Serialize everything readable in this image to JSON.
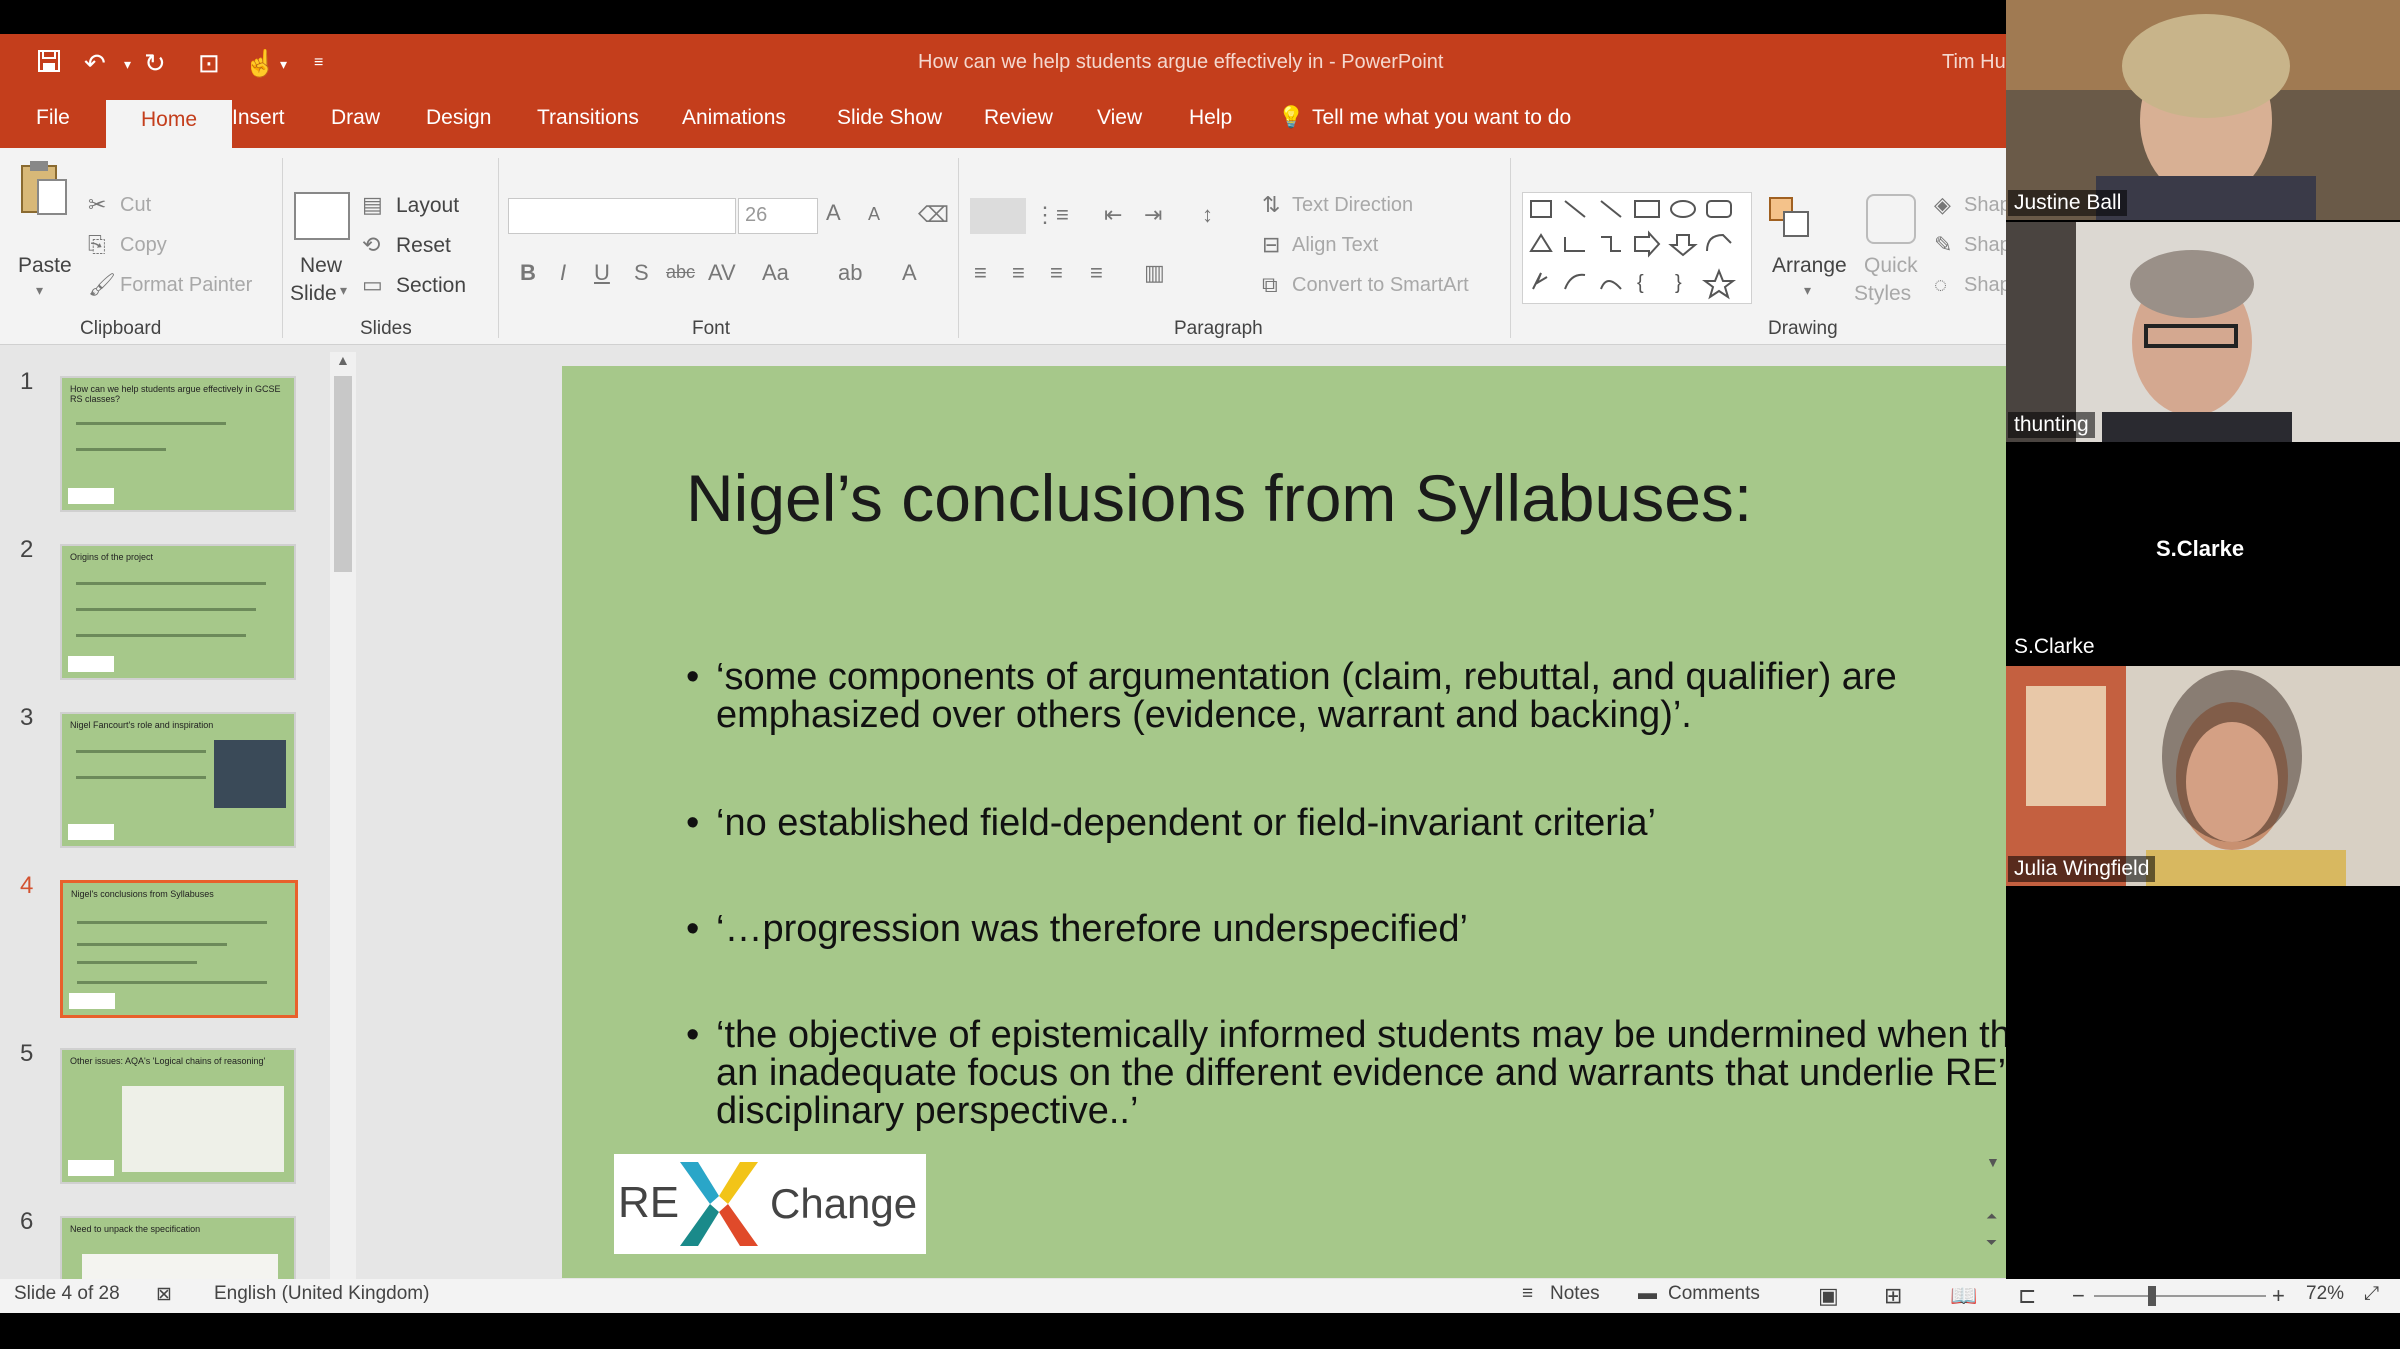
{
  "window": {
    "doc_title": "How can we help students argue effectively in  -  PowerPoint",
    "user": "Tim Hu"
  },
  "tabs": [
    "File",
    "Home",
    "Insert",
    "Draw",
    "Design",
    "Transitions",
    "Animations",
    "Slide Show",
    "Review",
    "View",
    "Help"
  ],
  "tell_me": "Tell me what you want to do",
  "ribbon": {
    "clipboard": {
      "paste": "Paste",
      "cut": "Cut",
      "copy": "Copy",
      "format_painter": "Format Painter",
      "group": "Clipboard"
    },
    "slides": {
      "new_slide_1": "New",
      "new_slide_2": "Slide",
      "layout": "Layout",
      "reset": "Reset",
      "section": "Section",
      "group": "Slides"
    },
    "font": {
      "font_size": "26",
      "group": "Font"
    },
    "paragraph": {
      "text_direction": "Text Direction",
      "align_text": "Align Text",
      "convert_smartart": "Convert to SmartArt",
      "group": "Paragraph"
    },
    "drawing": {
      "arrange": "Arrange",
      "quick_1": "Quick",
      "quick_2": "Styles",
      "shape_1": "Shap",
      "shape_2": "Shap",
      "shape_3": "Shap",
      "group": "Drawing"
    }
  },
  "thumbnails": [
    {
      "num": "1",
      "title": "How can we help students argue effectively in GCSE RS classes?"
    },
    {
      "num": "2",
      "title": "Origins of the project"
    },
    {
      "num": "3",
      "title": "Nigel Fancourt's role and inspiration"
    },
    {
      "num": "4",
      "title": "Nigel's conclusions from Syllabuses"
    },
    {
      "num": "5",
      "title": "Other issues: AQA's 'Logical chains of reasoning'"
    },
    {
      "num": "6",
      "title": "Need to unpack the specification"
    }
  ],
  "slide": {
    "title": "Nigel’s conclusions from Syllabuses:",
    "bullets": [
      "‘some components of argumentation (claim, rebuttal, and qualifier) are emphasized over others (evidence, warrant and backing)’.",
      "‘no established field-dependent or field-invariant criteria’",
      "‘…progression was therefore underspecified’",
      "‘the objective of epistemically informed students may be undermined when there is an inadequate focus on the different evidence and warrants that underlie RE’s inter-disciplinary perspective..’"
    ],
    "logo_left": "RE",
    "logo_right": "Change"
  },
  "status": {
    "slide_of": "Slide 4 of 28",
    "language": "English (United Kingdom)",
    "notes": "Notes",
    "comments": "Comments",
    "zoom": "72%"
  },
  "participants": [
    "Justine Ball",
    "thunting",
    "S.Clarke",
    "Julia Wingfield"
  ],
  "participant_center_name": "S.Clarke",
  "colors": {
    "accent": "#c43e1c",
    "slide_bg": "#a6c88a",
    "selected_thumb": "#e8602c"
  }
}
